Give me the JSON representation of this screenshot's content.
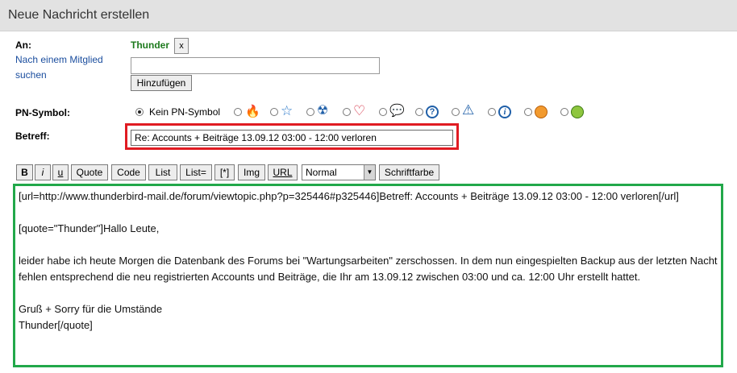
{
  "header": {
    "title": "Neue Nachricht erstellen"
  },
  "to": {
    "label": "An:",
    "find_member_link": "Nach einem Mitglied suchen",
    "recipient": "Thunder",
    "remove_label": "x",
    "input_value": "",
    "add_button": "Hinzufügen"
  },
  "pm_symbol": {
    "label": "PN-Symbol:",
    "none_label": "Kein PN-Symbol",
    "selected": "none",
    "icons": [
      "flame-icon",
      "star-icon",
      "radiation-icon",
      "heart-icon",
      "speech-bubble-icon",
      "question-icon",
      "warning-icon",
      "info-icon",
      "grin-smiley-icon",
      "grin-green-smiley-icon"
    ]
  },
  "subject": {
    "label": "Betreff:",
    "value": "Re: Accounts + Beiträge 13.09.12 03:00 - 12:00 verloren"
  },
  "toolbar": {
    "bold": "B",
    "italic": "i",
    "underline": "u",
    "quote": "Quote",
    "code": "Code",
    "list": "List",
    "list_eq": "List=",
    "list_item": "[*]",
    "img": "Img",
    "url": "URL",
    "font_size_selected": "Normal",
    "font_color": "Schriftfarbe"
  },
  "message": {
    "line1": "[url=http://www.thunderbird-mail.de/forum/viewtopic.php?p=325446#p325446]Betreff: Accounts + Beiträge 13.09.12 03:00 - 12:00 verloren[/url]",
    "line2": "[quote=\"Thunder\"]Hallo Leute,",
    "line3": "leider habe ich heute Morgen die Datenbank des Forums bei \"Wartungsarbeiten\" zerschossen. In dem nun eingespielten Backup aus der letzten Nacht fehlen entsprechend die neu registrierten Accounts und Beiträge, die Ihr am 13.09.12 zwischen 03:00 und ca. 12:00 Uhr erstellt hattet.",
    "line4": "Gruß + Sorry für die Umstände",
    "line5": "Thunder[/quote]"
  },
  "colors": {
    "subject_highlight": "#e01b22",
    "message_highlight": "#22a84a",
    "recipient": "#1d7a1d",
    "link": "#1a4d9e"
  }
}
